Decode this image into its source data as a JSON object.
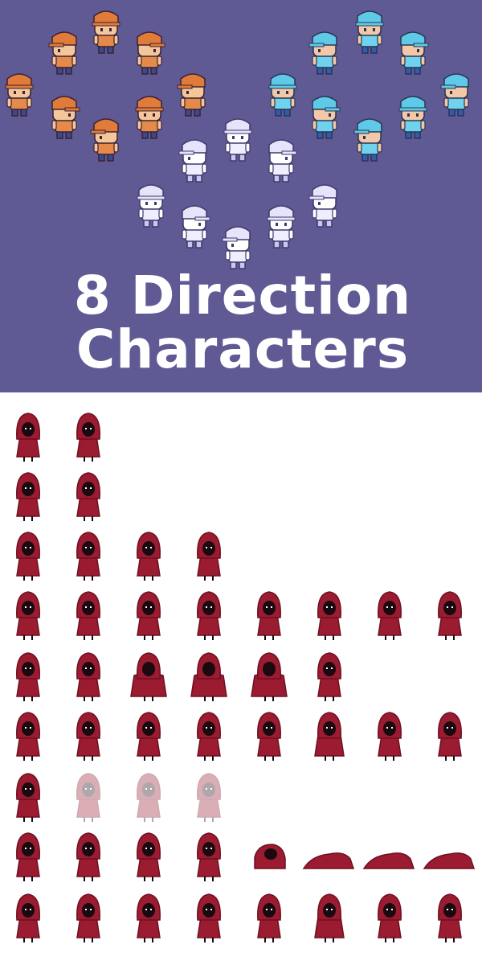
{
  "banner": {
    "title_line_1": "8 Direction",
    "title_line_2": "Characters",
    "background_color": "#5f5a94",
    "ring_groups": [
      {
        "name": "orange-cap-characters",
        "palette": {
          "skin": "#f4c69c",
          "cap": "#e07b39",
          "shirt": "#e58a4a",
          "pants": "#3b4a8c",
          "outline": "#3a2232"
        }
      },
      {
        "name": "blue-cap-characters",
        "palette": {
          "skin": "#f2c8a8",
          "cap": "#5fc9e8",
          "shirt": "#6fd3ef",
          "pants": "#345aa8",
          "outline": "#2a3552"
        }
      },
      {
        "name": "white-characters",
        "palette": {
          "skin": "#ffffff",
          "cap": "#e6e4fb",
          "shirt": "#eeeeff",
          "pants": "#c9c6f0",
          "outline": "#3d3a6b"
        }
      }
    ]
  },
  "sprite_sheet": {
    "sprite": "red-hooded-figure",
    "palette": {
      "cloak": "#9b1b30",
      "cloak_dark": "#6e1021",
      "face": "#1a0a10",
      "eye": "#ffffff"
    },
    "rows": [
      {
        "frames": [
          "hood-up",
          "hood-up"
        ]
      },
      {
        "frames": [
          "hood-up",
          "hood-up"
        ]
      },
      {
        "frames": [
          "walk",
          "walk",
          "walk",
          "walk"
        ]
      },
      {
        "frames": [
          "lean",
          "lean",
          "lean",
          "lean",
          "lean",
          "lean",
          "lean",
          "lean"
        ]
      },
      {
        "frames": [
          "hood-up",
          "hood-up",
          "wide",
          "wide",
          "wide",
          "hood-up"
        ]
      },
      {
        "frames": [
          "walk",
          "walk",
          "walk",
          "walk",
          "walk",
          "crouch",
          "walk",
          "walk"
        ]
      },
      {
        "frames": [
          "hood-up",
          "fade",
          "fade",
          "fade"
        ]
      },
      {
        "frames": [
          "walk",
          "walk",
          "walk",
          "walk",
          "lying",
          "flat",
          "flat",
          "flat"
        ]
      },
      {
        "frames": [
          "walk",
          "walk",
          "walk",
          "walk",
          "walk",
          "crouch",
          "walk",
          "walk"
        ]
      }
    ]
  }
}
